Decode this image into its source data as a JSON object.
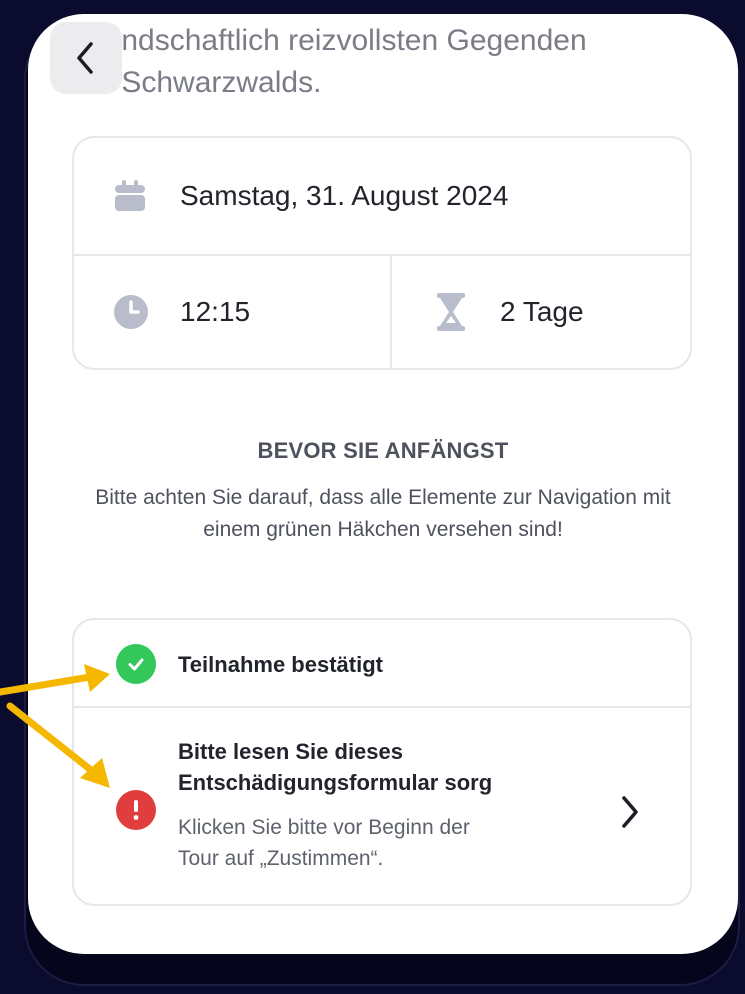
{
  "header": {
    "intro_line_1": "landschaftlich reizvollsten Gegenden",
    "intro_line_2": "s Schwarzwalds."
  },
  "tour_info": {
    "date": "Samstag, 31. August 2024",
    "time": "12:15",
    "duration": "2 Tage"
  },
  "preparation": {
    "title": "BEVOR SIE ANFÄNGST",
    "description": "Bitte achten Sie darauf, dass alle Elemente zur Navigation mit einem grünen Häkchen versehen sind!"
  },
  "checklist": {
    "items": [
      {
        "title": "Teilnahme bestätigt",
        "status": "done"
      },
      {
        "title_line_1": "Bitte lesen Sie dieses",
        "title_line_2": "Entschädigungsformular sorg",
        "subtitle_line_1": "Klicken Sie bitte vor Beginn der",
        "subtitle_line_2": "Tour auf „Zustimmen“.",
        "status": "pending"
      }
    ]
  },
  "colors": {
    "background": "#0b0b2e",
    "success": "#34c759",
    "error": "#e03e3e",
    "icon_gray": "#b9bccb",
    "annotation_arrow": "#f5b800"
  },
  "icons": {
    "back": "chevron-left-icon",
    "date": "calendar-icon",
    "time": "clock-icon",
    "duration": "hourglass-icon",
    "done": "check-circle-icon",
    "pending": "exclamation-circle-icon",
    "open": "chevron-right-icon"
  }
}
